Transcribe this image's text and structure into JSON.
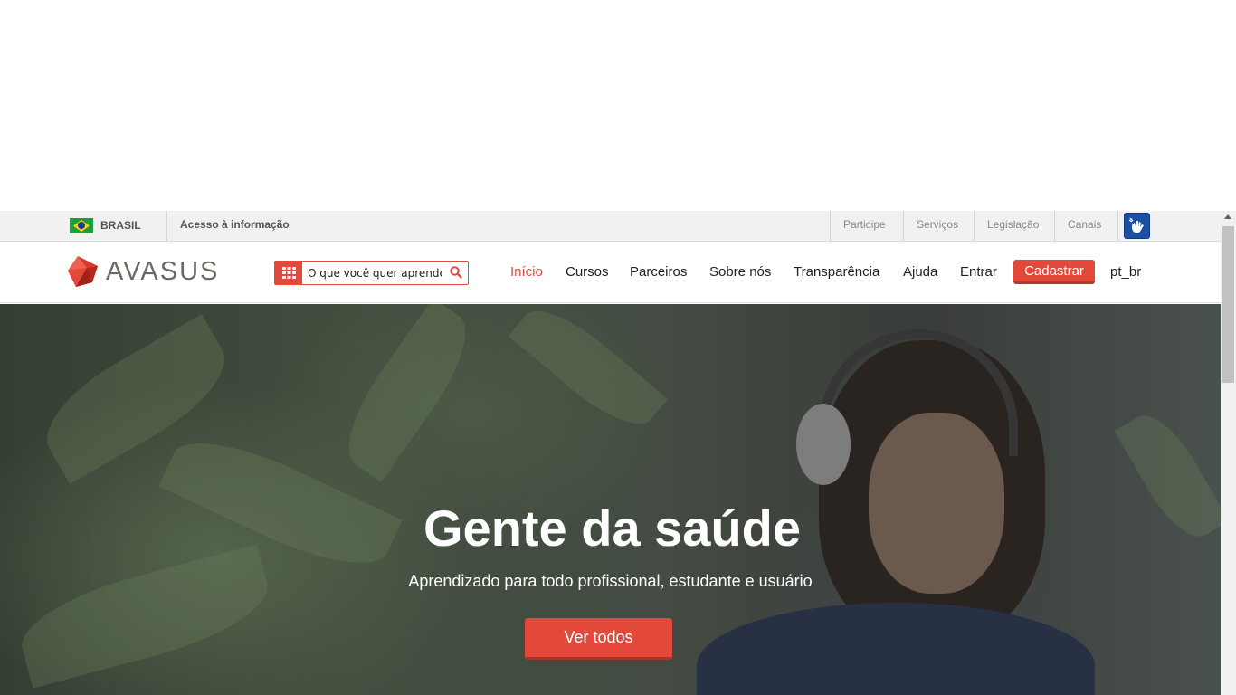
{
  "gov_bar": {
    "country": "BRASIL",
    "access": "Acesso à informação",
    "links": [
      "Participe",
      "Serviços",
      "Legislação",
      "Canais"
    ],
    "libras_icon": "hand-sign-icon"
  },
  "header": {
    "logo": {
      "left": "AVA",
      "right": "SUS"
    },
    "search": {
      "placeholder": "O que você quer aprender?"
    },
    "nav": [
      "Início",
      "Cursos",
      "Parceiros",
      "Sobre nós",
      "Transparência",
      "Ajuda",
      "Entrar"
    ],
    "signup": "Cadastrar",
    "language": "pt_br"
  },
  "hero": {
    "title": "Gente da saúde",
    "subtitle": "Aprendizado para todo profissional, estudante e usuário",
    "button": "Ver todos"
  },
  "colors": {
    "accent": "#e2493b",
    "govbar_bg": "#f1f1f1",
    "text": "#222222"
  }
}
